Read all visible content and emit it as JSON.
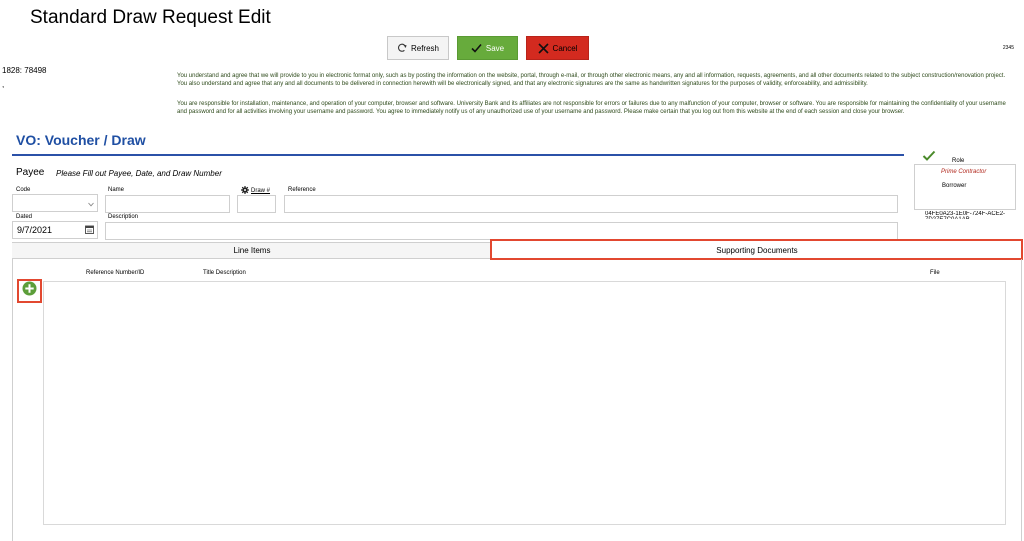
{
  "page": {
    "title": "Standard Draw Request Edit"
  },
  "toolbar": {
    "refresh_label": "Refresh",
    "save_label": "Save",
    "cancel_label": "Cancel"
  },
  "corner_number": "2345",
  "left_info": {
    "code": "1828: 78498",
    "punctuation": ","
  },
  "disclaimer": {
    "paragraph1": "You understand and agree that we will provide to you in electronic format only, such as by posting the information on the website, portal, through e-mail, or through other electronic means, any and all information, requests, agreements, and all other documents related to the subject construction/renovation project. You also understand and agree that any and all documents to be delivered in connection herewith will be electronically signed, and that any electronic signatures are the same as handwritten signatures for the purposes of validity, enforceability, and admissibility.",
    "paragraph2": "You are responsible for installation, maintenance, and operation of your computer, browser and software. University Bank and its affiliates are not responsible for errors or failures due to any malfunction of your computer, browser or software. You are responsible for maintaining the confidentiality of your username and password and for all activities involving your username and password. You agree to immediately notify us of any unauthorized use of your username and password. Please make certain that you log out from this website at the end of each session and close your browser."
  },
  "section": {
    "title": "VO: Voucher / Draw"
  },
  "payee": {
    "title": "Payee",
    "hint": "Please Fill out Payee, Date, and Draw Number",
    "code_label": "Code",
    "name_label": "Name",
    "draw_label": "Draw #",
    "reference_label": "Reference",
    "dated_label": "Dated",
    "dated_value": "9/7/2021",
    "description_label": "Description"
  },
  "role": {
    "label": "Role",
    "items": [
      "Prime Contractor",
      "Borrower"
    ],
    "guid": "04FE0A23-1E0F-724F-ACE2-7D27E7C0A1AB"
  },
  "tabs": {
    "line_items": "Line Items",
    "supporting_documents": "Supporting Documents"
  },
  "documents": {
    "columns": {
      "reference": "Reference Number/ID",
      "title": "Title Description",
      "file": "File"
    }
  },
  "colors": {
    "accent": "#1f4fa3",
    "save": "#67ab3c",
    "cancel": "#d32a1f",
    "highlight": "#e24830",
    "check": "#4a8a2a"
  },
  "icons": [
    "refresh-icon",
    "check-icon",
    "close-icon",
    "chevron-down-icon",
    "calendar-icon",
    "gear-icon",
    "add-icon"
  ]
}
